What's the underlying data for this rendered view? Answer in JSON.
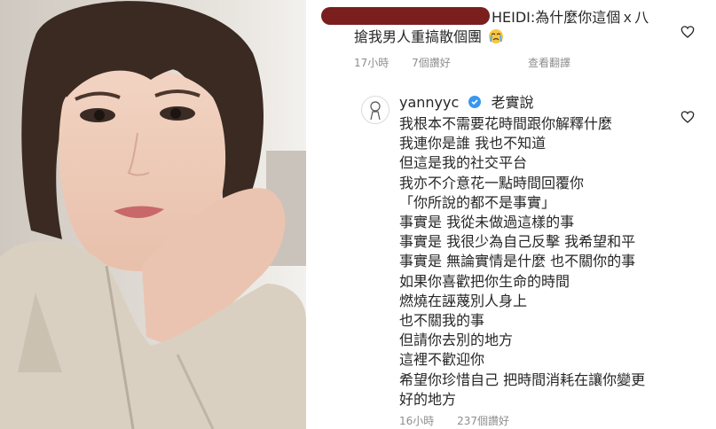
{
  "comment1": {
    "prefix_text": "HEIDI:為什麼你這個ｘ八",
    "line2": "搶我男人重搞散個團",
    "emoji": "crying-face-emoji",
    "time": "17小時",
    "likes": "7個讚好",
    "translate": "查看翻譯"
  },
  "comment2": {
    "username": "yannyyc",
    "first_text": "老實說",
    "lines": [
      "我根本不需要花時間跟你解釋什麼",
      "我連你是誰 我也不知道",
      "但這是我的社交平台",
      "我亦不介意花一點時間回覆你",
      "「你所說的都不是事實」",
      "事實是 我從未做過這樣的事",
      "事實是 我很少為自己反擊 我希望和平",
      "事實是 無論實情是什麼 也不關你的事",
      "如果你喜歡把你生命的時間",
      "燃燒在誣蔑別人身上",
      "也不關我的事",
      "但請你去別的地方",
      "這裡不歡迎你",
      "希望你珍惜自己 把時間消耗在讓你變更",
      "好的地方"
    ],
    "time": "16小時",
    "likes": "237個讚好"
  },
  "colors": {
    "text": "#262626",
    "meta": "#8e8e8e",
    "verified": "#3897f0",
    "redaction": "#7a1e1e"
  }
}
